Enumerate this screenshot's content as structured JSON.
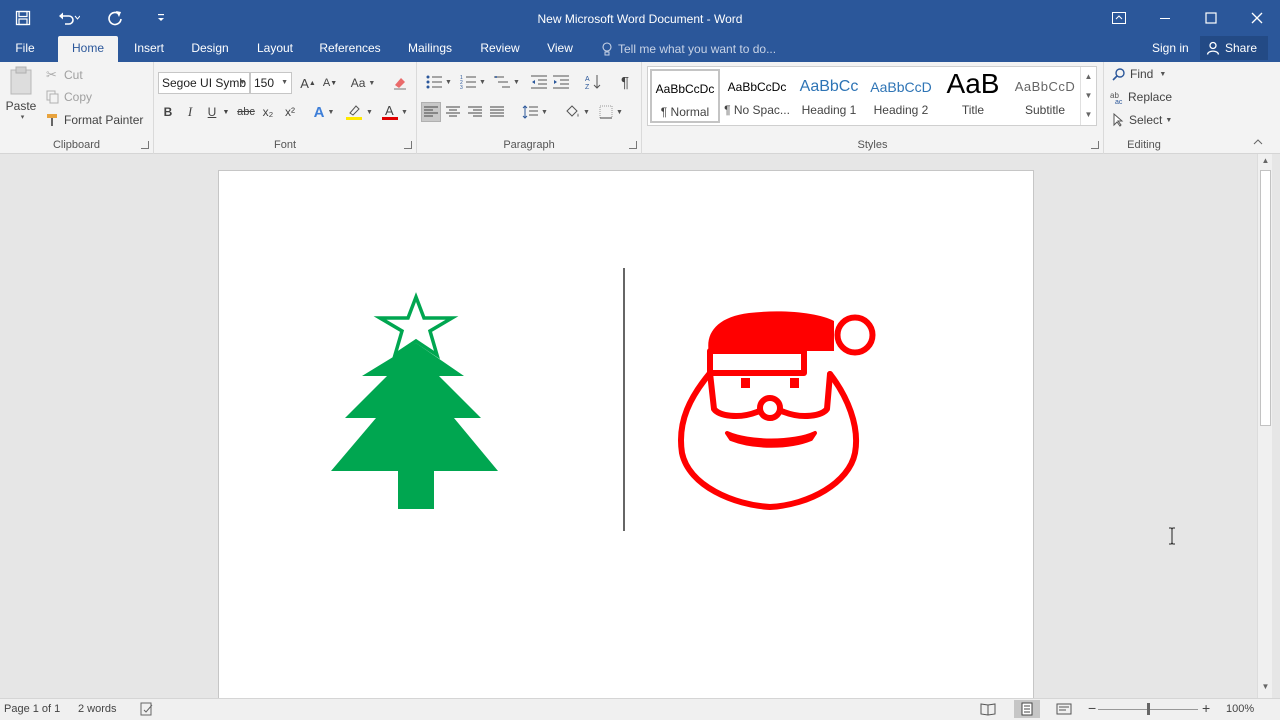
{
  "window": {
    "title": "New Microsoft Word Document - Word"
  },
  "tabs": {
    "file": "File",
    "items": [
      "Home",
      "Insert",
      "Design",
      "Layout",
      "References",
      "Mailings",
      "Review",
      "View"
    ],
    "active": "Home",
    "tell_me": "Tell me what you want to do...",
    "sign_in": "Sign in",
    "share": "Share"
  },
  "clipboard": {
    "label": "Clipboard",
    "paste": "Paste",
    "cut": "Cut",
    "copy": "Copy",
    "format_painter": "Format Painter"
  },
  "font": {
    "label": "Font",
    "family": "Segoe UI Symb",
    "size": "150",
    "bold": "B",
    "italic": "I",
    "underline": "U",
    "strikethrough": "abc",
    "subscript": "x₂",
    "superscript": "x²",
    "grow": "A",
    "shrink": "A",
    "change_case": "Aa"
  },
  "paragraph": {
    "label": "Paragraph",
    "pilcrow": "¶"
  },
  "styles": {
    "label": "Styles",
    "items": [
      {
        "preview": "AaBbCcDc",
        "name": "¶ Normal"
      },
      {
        "preview": "AaBbCcDc",
        "name": "¶ No Spac..."
      },
      {
        "preview": "AaBbCc",
        "name": "Heading 1"
      },
      {
        "preview": "AaBbCcD",
        "name": "Heading 2"
      },
      {
        "preview": "AaB",
        "name": "Title"
      },
      {
        "preview": "AaBbCcD",
        "name": "Subtitle"
      }
    ]
  },
  "editing": {
    "label": "Editing",
    "find": "Find",
    "replace": "Replace",
    "select": "Select"
  },
  "document": {
    "tree_color": "#00a650",
    "santa_color": "#ff0000"
  },
  "status": {
    "page": "Page 1 of 1",
    "words": "2 words",
    "zoom": "100%"
  }
}
